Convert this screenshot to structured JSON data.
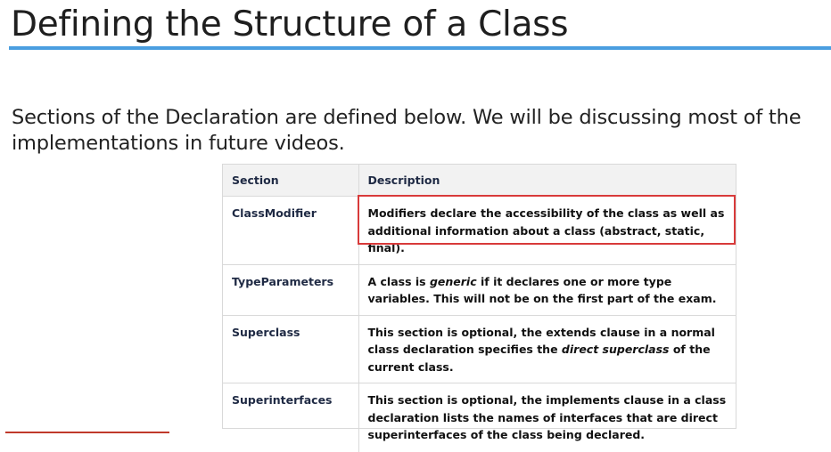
{
  "slide": {
    "title": "Defining the Structure of a Class",
    "intro": "Sections of the Declaration are defined below. We will be discussing most of the implementations in future videos."
  },
  "table": {
    "headers": {
      "section": "Section",
      "description": "Description"
    },
    "rows": [
      {
        "section": "ClassModifier",
        "description": [
          {
            "text": "Modifiers declare the accessibility of the class as well as additional information about a class (abstract,  static,  final).",
            "italic": false
          }
        ],
        "highlighted": true
      },
      {
        "section": "TypeParameters",
        "description": [
          {
            "text": "A class is ",
            "italic": false
          },
          {
            "text": "generic",
            "italic": true
          },
          {
            "text": " if it declares one or more type variables. This will not be on the first part of the exam.",
            "italic": false
          }
        ],
        "highlighted": false
      },
      {
        "section": "Superclass",
        "description": [
          {
            "text": "This section is optional, the extends clause in a normal class declaration specifies the ",
            "italic": false
          },
          {
            "text": "direct superclass",
            "italic": true
          },
          {
            "text": " of the current class.",
            "italic": false
          }
        ],
        "highlighted": false
      },
      {
        "section": "Superinterfaces",
        "description": [
          {
            "text": "This section is optional, the implements clause in a class declaration lists the names of interfaces that are direct superinterfaces of the class being declared.",
            "italic": false
          }
        ],
        "highlighted": false
      }
    ]
  },
  "colors": {
    "title_rule": "#4a9ee0",
    "highlight_border": "#d83a3a",
    "header_background": "#f2f2f2",
    "bottom_accent": "#c0392b"
  }
}
